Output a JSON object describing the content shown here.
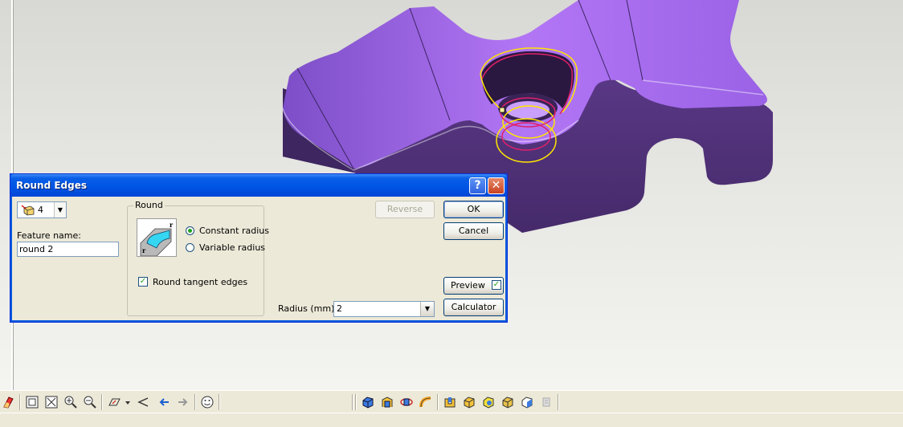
{
  "dialog": {
    "title": "Round Edges",
    "help_icon": "help-icon",
    "close_icon": "close-icon",
    "feature_select_value": "4",
    "feature_name_label": "Feature name:",
    "feature_name_value": "round 2",
    "round_group_label": "Round",
    "constant_radius_label": "Constant radius",
    "variable_radius_label": "Variable radius",
    "round_tangent_edges_label": "Round tangent edges",
    "round_tangent_edges_checked": true,
    "selected_mode": "constant",
    "reverse_label": "Reverse",
    "ok_label": "OK",
    "cancel_label": "Cancel",
    "preview_label": "Preview",
    "preview_checked": true,
    "calculator_label": "Calculator",
    "radius_label": "Radius (mm):",
    "radius_value": "2"
  },
  "colors": {
    "model_face": "#a064e8",
    "model_side": "#55317f",
    "highlight_yellow": "#ffe600",
    "highlight_red": "#e0206a",
    "title_blue": "#0055e5"
  },
  "toolbar": {
    "icons": [
      "eraser-icon",
      "zoom-fit-icon",
      "zoom-window-icon",
      "zoom-in-icon",
      "zoom-out-icon",
      "view-plane-icon",
      "view-dropdown-icon",
      "view-back-icon",
      "view-previous-icon",
      "view-next-icon",
      "smiley-icon",
      "shaded-box-icon",
      "extrude-icon",
      "revolve-icon",
      "sweep-icon",
      "shell-icon",
      "box-icon",
      "cube-icon",
      "solid-box-icon",
      "wireframe-box-icon",
      "disabled-tool-icon"
    ]
  }
}
